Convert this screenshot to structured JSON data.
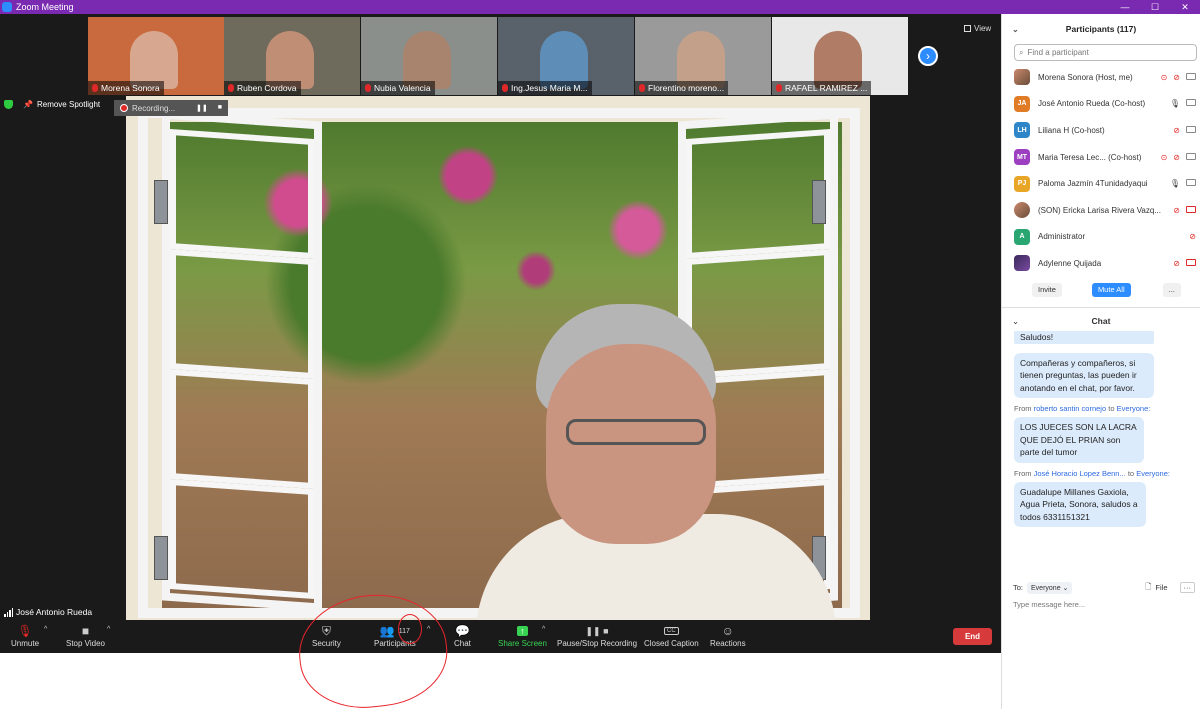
{
  "window": {
    "title": "Zoom Meeting",
    "min": "—",
    "max": "☐",
    "close": "✕"
  },
  "strip": {
    "tiles": [
      {
        "name": "Morena Sonora",
        "bg": "#c96a3e",
        "face": "#d8a78f"
      },
      {
        "name": "Ruben Cordova",
        "bg": "#6e6a5c",
        "face": "#c08e75"
      },
      {
        "name": "Nubia Valencia",
        "bg": "#8a8f8c",
        "face": "#a8846e"
      },
      {
        "name": "Ing.Jesus Maria M...",
        "bg": "#59626a",
        "face": "#5e8db8"
      },
      {
        "name": "Florentino moreno...",
        "bg": "#9a9a9a",
        "face": "#c2a08a"
      },
      {
        "name": "RAFAEL RAMIREZ ...",
        "bg": "#e8e8e8",
        "face": "#b07c66"
      }
    ],
    "view_label": "View",
    "next": "›"
  },
  "spotlight": {
    "remove_label": "Remove Spotlight"
  },
  "recording": {
    "label": "Recording...",
    "pause": "❚❚",
    "stop": "■"
  },
  "speaker": {
    "name": "José Antonio Rueda"
  },
  "toolbar": {
    "unmute": "Unmute",
    "stop_video": "Stop Video",
    "security": "Security",
    "participants": "Participants",
    "participant_count": "117",
    "chat": "Chat",
    "share_screen": "Share Screen",
    "pause_stop_recording": "Pause/Stop Recording",
    "closed_caption": "Closed Caption",
    "cc_badge": "CC",
    "reactions": "Reactions",
    "end": "End"
  },
  "participants_panel": {
    "title": "Participants (117)",
    "search_placeholder": "Find a participant",
    "rows": [
      {
        "name": "Morena Sonora (Host, me)",
        "initials": "",
        "color": "",
        "img": true
      },
      {
        "name": "José Antonio Rueda (Co-host)",
        "initials": "JA",
        "color": "#e07b26"
      },
      {
        "name": "Liliana H (Co-host)",
        "initials": "LH",
        "color": "#2e86c8"
      },
      {
        "name": "Maria Teresa Lec...  (Co-host)",
        "initials": "MT",
        "color": "#9c3fc0"
      },
      {
        "name": "Paloma Jazmín 4Tunidadyaqui",
        "initials": "PJ",
        "color": "#e8a526"
      },
      {
        "name": "(SON) Ericka Larisa Rivera Vazq...",
        "initials": "",
        "color": "",
        "img": true
      },
      {
        "name": "Administrator",
        "initials": "A",
        "color": "#2aa672"
      },
      {
        "name": "Adylenne Quijada",
        "initials": "",
        "color": "",
        "img": true
      }
    ],
    "invite": "Invite",
    "mute_all": "Mute All",
    "more": "..."
  },
  "chat": {
    "title": "Chat",
    "partial_message": "Saludos!",
    "messages": [
      {
        "from": "",
        "to": "",
        "text": "Compañeras y compañeros, si tienen preguntas, las pueden ir anotando en el chat, por favor."
      },
      {
        "from": "roberto santin cornejo",
        "to": "Everyone:",
        "text": "LOS JUECES SON LA LACRA QUE DEJÓ EL PRIAN son parte del tumor"
      },
      {
        "from": "José Horacio Lopez Benn...",
        "to": "Everyone:",
        "text": "Guadalupe Millanes Gaxiola, Agua Prieta, Sonora, saludos a todos 6331151321"
      }
    ],
    "from_prefix": "From",
    "to_word": "to",
    "to_label": "To:",
    "to_value": "Everyone",
    "file_label": "File",
    "more": "···",
    "input_placeholder": "Type message here..."
  }
}
